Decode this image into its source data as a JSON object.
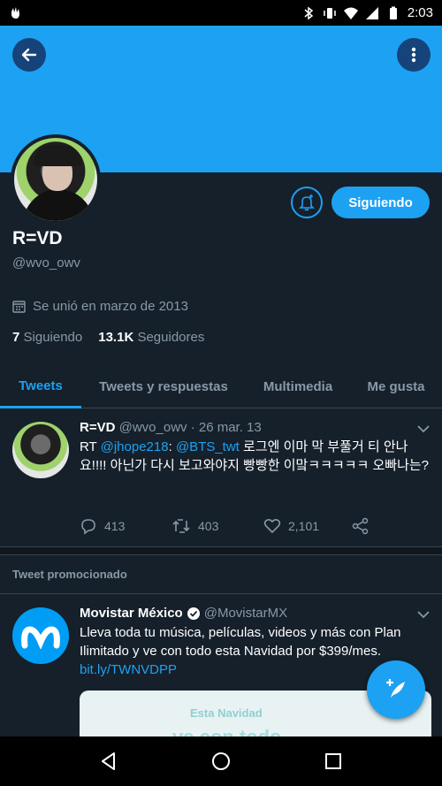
{
  "status_bar": {
    "time": "2:03"
  },
  "profile": {
    "name": "R=VD",
    "handle": "@wvo_owv",
    "joined": "Se unió en marzo de 2013",
    "following_count": "7",
    "following_label": "Siguiendo",
    "followers_count": "13.1K",
    "followers_label": "Seguidores",
    "follow_button_label": "Siguiendo"
  },
  "tabs": [
    {
      "label": "Tweets",
      "active": true
    },
    {
      "label": "Tweets y respuestas",
      "active": false
    },
    {
      "label": "Multimedia",
      "active": false
    },
    {
      "label": "Me gusta",
      "active": false
    }
  ],
  "tweet": {
    "author": "R=VD",
    "handle": "@wvo_owv",
    "date": "· 26 mar. 13",
    "rt": "RT",
    "mention1": "@jhope218",
    "colon": ":",
    "mention2": "@BTS_twt",
    "body": "로그엔 이마 막 부풀거 티 안나요!!!! 아닌가 다시 보고와야지 빵빵한 이맠ㅋㅋㅋㅋㅋ 오빠나는?",
    "replies": "413",
    "retweets": "403",
    "likes": "2,101"
  },
  "promoted_label": "Tweet promocionado",
  "ad": {
    "author": "Movistar México",
    "handle": "@MovistarMX",
    "text": "Lleva toda tu música, películas, videos y más con Plan Ilimitado y ve con todo esta Navidad por $399/mes.",
    "link": "bit.ly/TWNVDPP",
    "image_text_small": "Esta Navidad",
    "image_text_big": "ve con todo"
  },
  "colors": {
    "accent": "#1da1f2",
    "background": "#15202b",
    "muted": "#8899a6"
  }
}
